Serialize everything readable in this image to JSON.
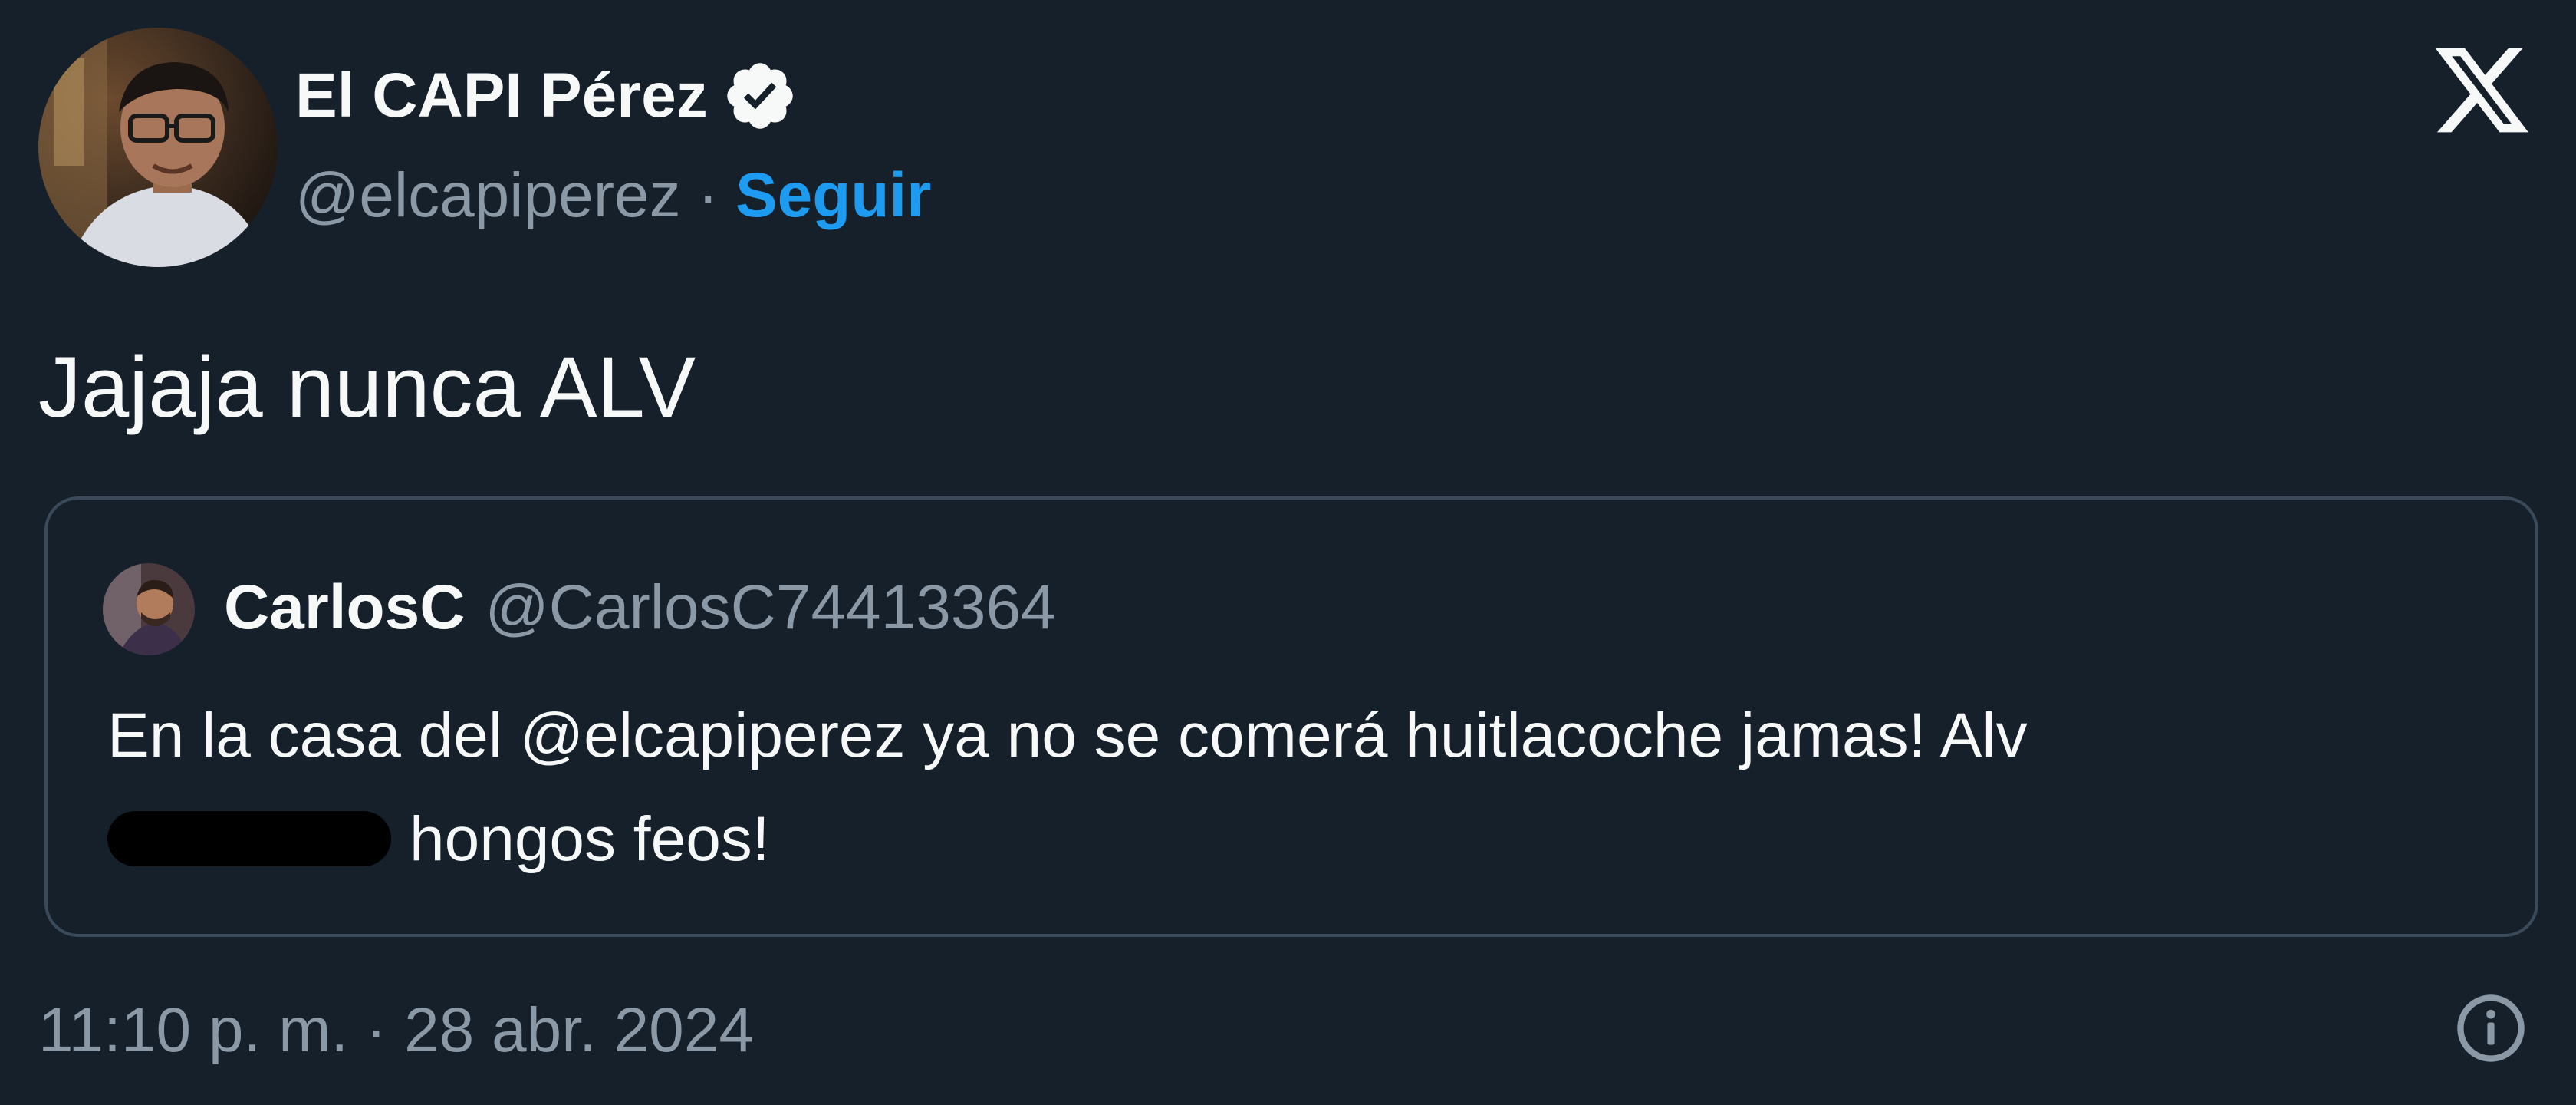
{
  "author": {
    "display_name": "El CAPI Pérez",
    "verified": true,
    "handle": "@elcapiperez",
    "separator": "·",
    "follow_label": "Seguir",
    "avatar_icon": "user-avatar-photo"
  },
  "platform": {
    "logo_icon": "x-logo-icon"
  },
  "tweet": {
    "text": "Jajaja nunca ALV"
  },
  "quote": {
    "display_name": "CarlosC",
    "handle": "@CarlosC74413364",
    "avatar_icon": "user-avatar-photo",
    "text_line1": "En la casa del @elcapiperez ya no se comerá huitlacoche jamas! Alv",
    "text_line2": "hongos feos!",
    "redacted": true
  },
  "footer": {
    "timestamp": "11:10 p. m. · 28 abr. 2024",
    "info_icon": "info-icon"
  },
  "colors": {
    "background": "#15202b",
    "text_primary": "#f7f9f9",
    "text_secondary": "#8b98a5",
    "accent": "#1d9bf0",
    "quote_border": "#3a4a5a"
  }
}
